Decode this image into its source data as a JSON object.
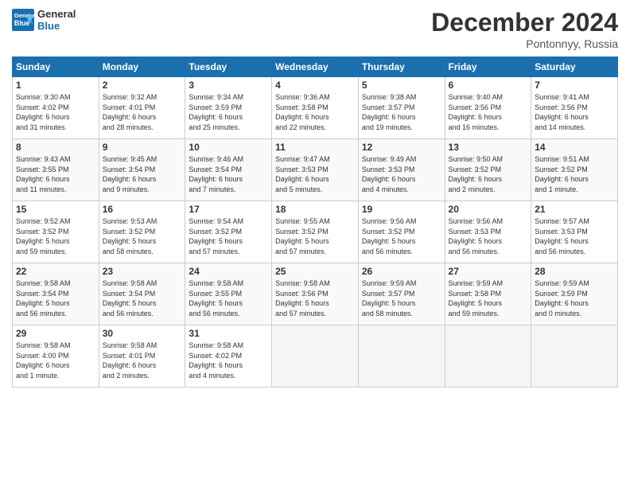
{
  "logo": {
    "line1": "General",
    "line2": "Blue"
  },
  "title": "December 2024",
  "subtitle": "Pontonnyy, Russia",
  "headers": [
    "Sunday",
    "Monday",
    "Tuesday",
    "Wednesday",
    "Thursday",
    "Friday",
    "Saturday"
  ],
  "weeks": [
    [
      {
        "day": "1",
        "info": "Sunrise: 9:30 AM\nSunset: 4:02 PM\nDaylight: 6 hours\nand 31 minutes."
      },
      {
        "day": "2",
        "info": "Sunrise: 9:32 AM\nSunset: 4:01 PM\nDaylight: 6 hours\nand 28 minutes."
      },
      {
        "day": "3",
        "info": "Sunrise: 9:34 AM\nSunset: 3:59 PM\nDaylight: 6 hours\nand 25 minutes."
      },
      {
        "day": "4",
        "info": "Sunrise: 9:36 AM\nSunset: 3:58 PM\nDaylight: 6 hours\nand 22 minutes."
      },
      {
        "day": "5",
        "info": "Sunrise: 9:38 AM\nSunset: 3:57 PM\nDaylight: 6 hours\nand 19 minutes."
      },
      {
        "day": "6",
        "info": "Sunrise: 9:40 AM\nSunset: 3:56 PM\nDaylight: 6 hours\nand 16 minutes."
      },
      {
        "day": "7",
        "info": "Sunrise: 9:41 AM\nSunset: 3:56 PM\nDaylight: 6 hours\nand 14 minutes."
      }
    ],
    [
      {
        "day": "8",
        "info": "Sunrise: 9:43 AM\nSunset: 3:55 PM\nDaylight: 6 hours\nand 11 minutes."
      },
      {
        "day": "9",
        "info": "Sunrise: 9:45 AM\nSunset: 3:54 PM\nDaylight: 6 hours\nand 9 minutes."
      },
      {
        "day": "10",
        "info": "Sunrise: 9:46 AM\nSunset: 3:54 PM\nDaylight: 6 hours\nand 7 minutes."
      },
      {
        "day": "11",
        "info": "Sunrise: 9:47 AM\nSunset: 3:53 PM\nDaylight: 6 hours\nand 5 minutes."
      },
      {
        "day": "12",
        "info": "Sunrise: 9:49 AM\nSunset: 3:53 PM\nDaylight: 6 hours\nand 4 minutes."
      },
      {
        "day": "13",
        "info": "Sunrise: 9:50 AM\nSunset: 3:52 PM\nDaylight: 6 hours\nand 2 minutes."
      },
      {
        "day": "14",
        "info": "Sunrise: 9:51 AM\nSunset: 3:52 PM\nDaylight: 6 hours\nand 1 minute."
      }
    ],
    [
      {
        "day": "15",
        "info": "Sunrise: 9:52 AM\nSunset: 3:52 PM\nDaylight: 5 hours\nand 59 minutes."
      },
      {
        "day": "16",
        "info": "Sunrise: 9:53 AM\nSunset: 3:52 PM\nDaylight: 5 hours\nand 58 minutes."
      },
      {
        "day": "17",
        "info": "Sunrise: 9:54 AM\nSunset: 3:52 PM\nDaylight: 5 hours\nand 57 minutes."
      },
      {
        "day": "18",
        "info": "Sunrise: 9:55 AM\nSunset: 3:52 PM\nDaylight: 5 hours\nand 57 minutes."
      },
      {
        "day": "19",
        "info": "Sunrise: 9:56 AM\nSunset: 3:52 PM\nDaylight: 5 hours\nand 56 minutes."
      },
      {
        "day": "20",
        "info": "Sunrise: 9:56 AM\nSunset: 3:53 PM\nDaylight: 5 hours\nand 56 minutes."
      },
      {
        "day": "21",
        "info": "Sunrise: 9:57 AM\nSunset: 3:53 PM\nDaylight: 5 hours\nand 56 minutes."
      }
    ],
    [
      {
        "day": "22",
        "info": "Sunrise: 9:58 AM\nSunset: 3:54 PM\nDaylight: 5 hours\nand 56 minutes."
      },
      {
        "day": "23",
        "info": "Sunrise: 9:58 AM\nSunset: 3:54 PM\nDaylight: 5 hours\nand 56 minutes."
      },
      {
        "day": "24",
        "info": "Sunrise: 9:58 AM\nSunset: 3:55 PM\nDaylight: 5 hours\nand 56 minutes."
      },
      {
        "day": "25",
        "info": "Sunrise: 9:58 AM\nSunset: 3:56 PM\nDaylight: 5 hours\nand 57 minutes."
      },
      {
        "day": "26",
        "info": "Sunrise: 9:59 AM\nSunset: 3:57 PM\nDaylight: 5 hours\nand 58 minutes."
      },
      {
        "day": "27",
        "info": "Sunrise: 9:59 AM\nSunset: 3:58 PM\nDaylight: 5 hours\nand 59 minutes."
      },
      {
        "day": "28",
        "info": "Sunrise: 9:59 AM\nSunset: 3:59 PM\nDaylight: 6 hours\nand 0 minutes."
      }
    ],
    [
      {
        "day": "29",
        "info": "Sunrise: 9:58 AM\nSunset: 4:00 PM\nDaylight: 6 hours\nand 1 minute."
      },
      {
        "day": "30",
        "info": "Sunrise: 9:58 AM\nSunset: 4:01 PM\nDaylight: 6 hours\nand 2 minutes."
      },
      {
        "day": "31",
        "info": "Sunrise: 9:58 AM\nSunset: 4:02 PM\nDaylight: 6 hours\nand 4 minutes."
      },
      {
        "day": "",
        "info": ""
      },
      {
        "day": "",
        "info": ""
      },
      {
        "day": "",
        "info": ""
      },
      {
        "day": "",
        "info": ""
      }
    ]
  ]
}
